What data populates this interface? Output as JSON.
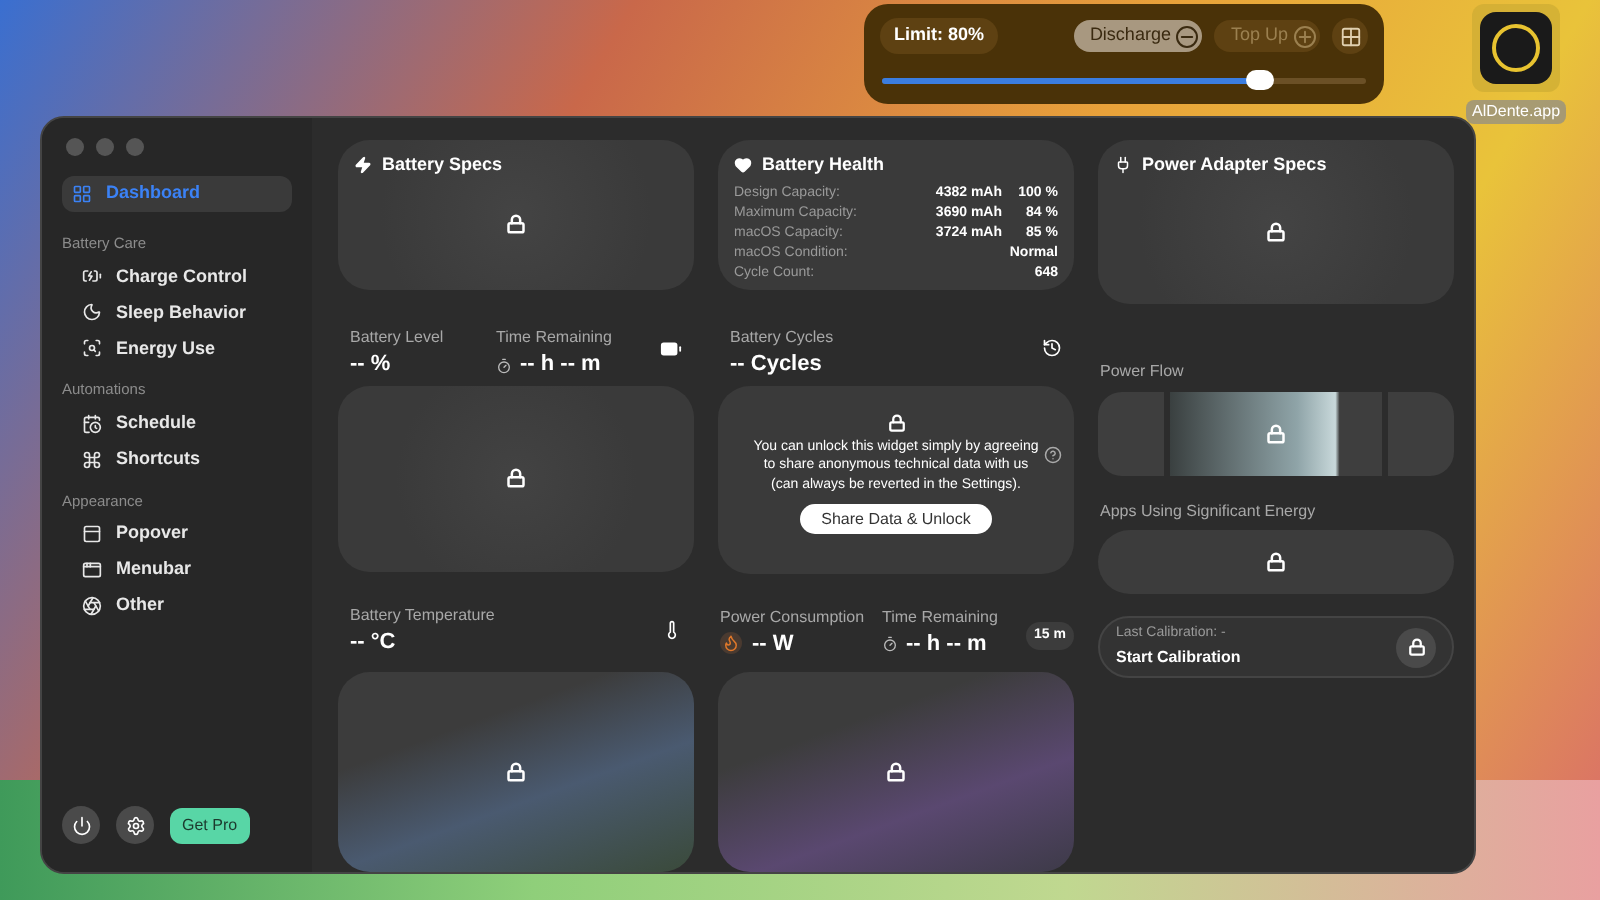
{
  "popover": {
    "limit": "Limit: 80%",
    "buttons": [
      {
        "label": "Discharge",
        "selected": true
      },
      {
        "label": "Top Up",
        "selected": false
      }
    ],
    "level": 0.78
  },
  "desktop_icon": {
    "label": "AlDente.app"
  },
  "sidebar": {
    "items": [
      {
        "kind": "item",
        "label": "Dashboard",
        "selected": true
      },
      {
        "kind": "section",
        "label": "Battery Care"
      },
      {
        "kind": "item",
        "label": "Charge Control",
        "selected": false
      },
      {
        "kind": "item",
        "label": "Sleep Behavior",
        "selected": false
      },
      {
        "kind": "item",
        "label": "Energy Use",
        "selected": false
      },
      {
        "kind": "section",
        "label": "Automations"
      },
      {
        "kind": "item",
        "label": "Schedule",
        "selected": false
      },
      {
        "kind": "item",
        "label": "Shortcuts",
        "selected": false
      },
      {
        "kind": "section",
        "label": "Appearance"
      },
      {
        "kind": "item",
        "label": "Popover",
        "selected": false
      },
      {
        "kind": "item",
        "label": "Menubar",
        "selected": false
      },
      {
        "kind": "item",
        "label": "Other",
        "selected": false
      }
    ],
    "pro_button": "Get Pro"
  },
  "battery_specs": {
    "title": "Battery Specs"
  },
  "battery_health": {
    "title": "Battery Health",
    "rows": [
      {
        "label": "Design Capacity:",
        "value": "4382 mAh",
        "percent": "100 %"
      },
      {
        "label": "Maximum Capacity:",
        "value": "3690 mAh",
        "percent": "84 %"
      },
      {
        "label": "macOS Capacity:",
        "value": "3724 mAh",
        "percent": "85 %"
      },
      {
        "label": "macOS Condition:",
        "value": "Normal"
      },
      {
        "label": "Cycle Count:",
        "value": "648"
      }
    ]
  },
  "power_adapter_specs": {
    "title": "Power Adapter Specs"
  },
  "battery_level": {
    "label": "Battery Level",
    "value": "-- %",
    "time_label": "Time Remaining",
    "time_value": "-- h -- m"
  },
  "battery_cycles": {
    "label": "Battery Cycles",
    "value": "-- Cycles",
    "message": "You can unlock this widget simply by agreeing to share anonymous technical data with us (can always be reverted in the Settings).",
    "button": "Share Data & Unlock"
  },
  "power_flow": {
    "label": "Power Flow"
  },
  "apps_energy": {
    "label": "Apps Using Significant Energy"
  },
  "calibration": {
    "label": "Last Calibration: -",
    "action": "Start Calibration"
  },
  "battery_temperature": {
    "label": "Battery Temperature",
    "value": "-- °C"
  },
  "power_consumption": {
    "label": "Power Consumption",
    "value": "-- W",
    "time_label": "Time Remaining",
    "time_value": "-- h -- m",
    "range": "15 m"
  }
}
